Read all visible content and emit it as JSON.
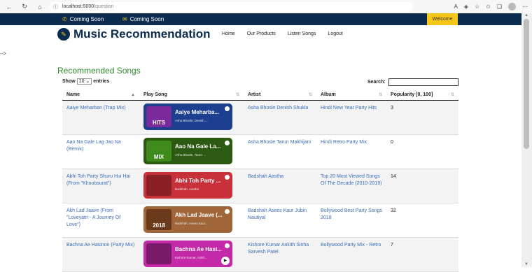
{
  "browser": {
    "url_host": "localhost:5000",
    "url_path": "/question"
  },
  "topbar": {
    "phone_text": "Coming Soon",
    "mail_text": "Coming Soon",
    "welcome": "Welcome"
  },
  "header": {
    "brand": "Music Recommendation",
    "nav": [
      "Home",
      "Our Products",
      "Listen Songs",
      "Logout"
    ]
  },
  "stray_text": "-->",
  "section_title": "Recommended Songs",
  "table_controls": {
    "show_label": "Show",
    "entries_value": "10",
    "entries_label": "entries",
    "search_label": "Search:"
  },
  "columns": [
    "Name",
    "Play Song",
    "Artist",
    "Album",
    "Popularity [0, 100]"
  ],
  "rows": [
    {
      "name": "Aaiye Meharban (Trap Mix)",
      "card_title": "Aaiye Meharba...",
      "card_sub": "Asha Bhosle, Denish ...",
      "cover_text": "HITS",
      "card_color": "#1d3f8f",
      "cover_color": "#7a2a9a",
      "artist": "Asha Bhosle Denish Shukla",
      "album": "Hindi New Year Party Hits",
      "popularity": "3"
    },
    {
      "name": "Aao Na Gale Lag Jao Na (Remix)",
      "card_title": "Aao Na Gale La...",
      "card_sub": "Asha Bhosle, Tarun ...",
      "cover_text": "MIX",
      "card_color": "#2d5a12",
      "cover_color": "#3e8a1a",
      "artist": "Asha Bhosle Tarun Makhijani",
      "album": "Hindi Retro Party Mix",
      "popularity": "0"
    },
    {
      "name": "Abhi Toh Party Shuru Hui Hai (From \"Khoobsurat\")",
      "card_title": "Abhi Toh Party ...",
      "card_sub": "Badshah, Aastha",
      "cover_text": "",
      "card_color": "#c8303a",
      "cover_color": "#8a1f26",
      "artist": "Badshah Aastha",
      "album": "Top 20 Most Viewed Songs Of The Decade (2010-2019)",
      "popularity": "14"
    },
    {
      "name": "Akh Lad Jaave (From \"Loveyatri - A Journey Of Love\")",
      "card_title": "Akh Lad Jaave (...",
      "card_sub": "Badshah, Asees Kaur...",
      "cover_text": "2018",
      "card_color": "#a0663a",
      "cover_color": "#6a3a1a",
      "artist": "Badshah Asees Kaur Jubin Nautiyal",
      "album": "Bollywood Best Party Songs 2018",
      "popularity": "32"
    },
    {
      "name": "Bachna Ae Hasinon (Party Mix)",
      "card_title": "Bachna Ae Hasi...",
      "card_sub": "Kishore Kumar, Ankit...",
      "cover_text": "",
      "card_color": "#c42aa8",
      "cover_color": "#7a1a6a",
      "artist": "Kishore Kumar Ankith Sinha Sarvesh Patel",
      "album": "Bollywood Party Mix - Retro",
      "popularity": "7"
    }
  ]
}
